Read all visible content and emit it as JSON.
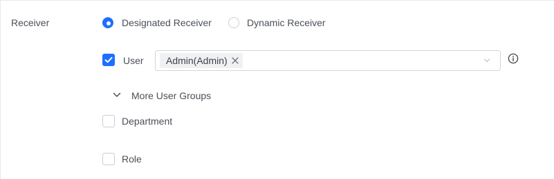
{
  "field_label": "Receiver",
  "receiver_type": {
    "options": [
      {
        "label": "Designated Receiver",
        "selected": true
      },
      {
        "label": "Dynamic Receiver",
        "selected": false
      }
    ]
  },
  "user": {
    "label": "User",
    "checked": true,
    "selected_tags": [
      "Admin(Admin)"
    ]
  },
  "more_user_groups_label": "More User Groups",
  "department": {
    "label": "Department",
    "checked": false
  },
  "role": {
    "label": "Role",
    "checked": false
  },
  "colors": {
    "accent": "#1e6fff",
    "border": "#d3d6dc",
    "tag_bg": "#f0f1f3"
  }
}
